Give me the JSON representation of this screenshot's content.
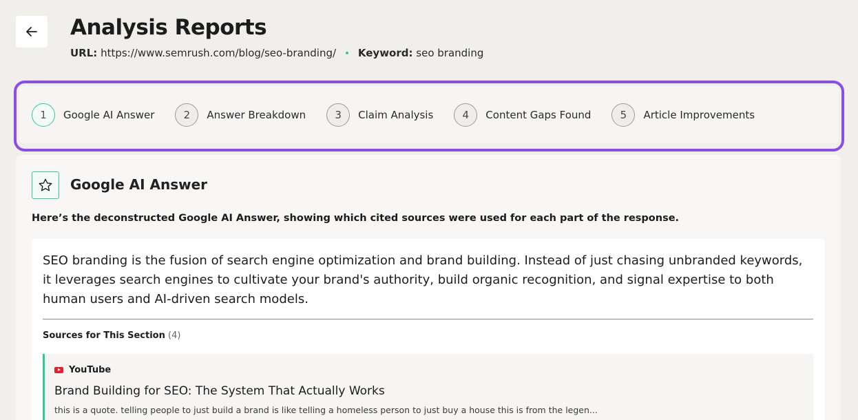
{
  "header": {
    "title": "Analysis Reports",
    "url_label": "URL:",
    "url_value": "https://www.semrush.com/blog/seo-branding/",
    "separator": "•",
    "keyword_label": "Keyword:",
    "keyword_value": "seo branding",
    "back_icon": "arrow-left-icon"
  },
  "stepper": {
    "steps": [
      {
        "num": "1",
        "label": "Google AI Answer",
        "active": true
      },
      {
        "num": "2",
        "label": "Answer Breakdown",
        "active": false
      },
      {
        "num": "3",
        "label": "Claim Analysis",
        "active": false
      },
      {
        "num": "4",
        "label": "Content Gaps Found",
        "active": false
      },
      {
        "num": "5",
        "label": "Article Improvements",
        "active": false
      }
    ]
  },
  "section": {
    "icon": "star-icon",
    "title": "Google AI Answer",
    "description": "Here’s the deconstructed Google AI Answer, showing which cited sources were used for each part of the response.",
    "answer": "SEO branding is the fusion of search engine optimization and brand building. Instead of just chasing unbranded keywords, it leverages search engines to cultivate your brand's authority, build organic recognition, and signal expertise to both human users and AI-driven search models.",
    "sources_label": "Sources for This Section",
    "sources_count": "(4)",
    "sources": [
      {
        "platform": "YouTube",
        "platform_icon": "youtube-icon",
        "title": "Brand Building for SEO: The System That Actually Works",
        "quote": "this is a quote. telling people to just build a brand is like telling a homeless person to just buy a house this is from the legen..."
      }
    ]
  },
  "colors": {
    "accent_teal": "#2fc9a0",
    "highlight_purple": "#8b4de8",
    "youtube_red": "#e8202a",
    "background": "#f1efec"
  }
}
